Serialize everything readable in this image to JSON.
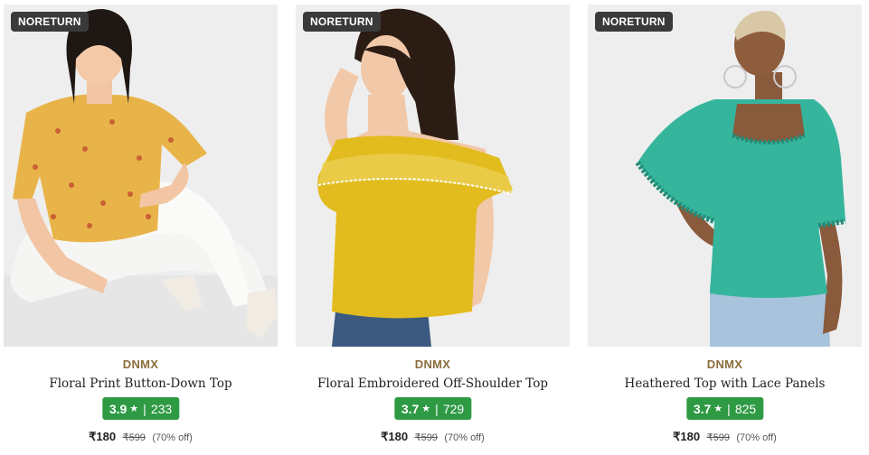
{
  "products": [
    {
      "badge": "NORETURN",
      "brand": "DNMX",
      "name": "Floral Print Button-Down Top",
      "rating": "3.9",
      "reviews": "233",
      "price": "₹180",
      "mrp": "₹599",
      "discount": "(70% off)"
    },
    {
      "badge": "NORETURN",
      "brand": "DNMX",
      "name": "Floral Embroidered Off-Shoulder Top",
      "rating": "3.7",
      "reviews": "729",
      "price": "₹180",
      "mrp": "₹599",
      "discount": "(70% off)"
    },
    {
      "badge": "NORETURN",
      "brand": "DNMX",
      "name": "Heathered Top with Lace Panels",
      "rating": "3.7",
      "reviews": "825",
      "price": "₹180",
      "mrp": "₹599",
      "discount": "(70% off)"
    }
  ],
  "colors": {
    "badge_bg": "#3a3a3a",
    "brand": "#8a6d3b",
    "rating_bg": "#2e9a44",
    "photo_bg": "#ededed"
  },
  "icons": {
    "rating_star": "star-icon"
  },
  "separator": "|"
}
